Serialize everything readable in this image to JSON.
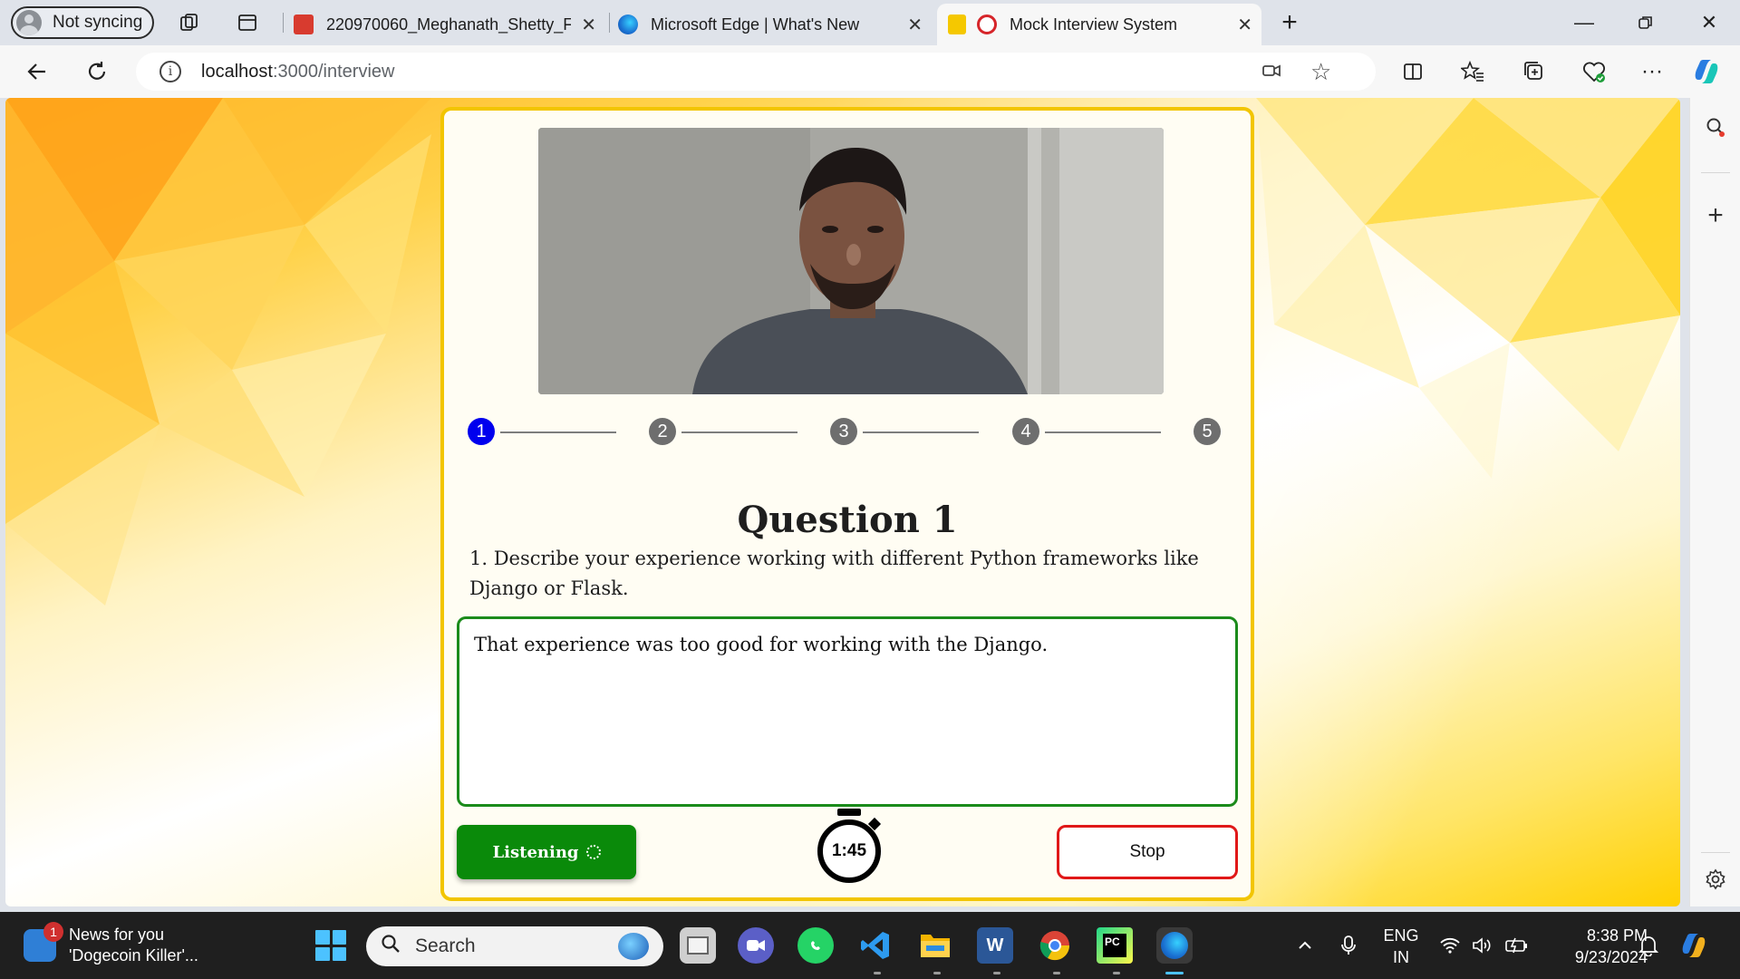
{
  "browser": {
    "profile_label": "Not syncing",
    "tabs": [
      {
        "label": "220970060_Meghanath_Shetty_Fi",
        "icon": "pdf-icon",
        "active": false
      },
      {
        "label": "Microsoft Edge | What's New",
        "icon": "edge-icon",
        "active": false
      },
      {
        "label": "Mock Interview System",
        "icon": "recording-icon",
        "active": true
      }
    ],
    "url_host": "localhost",
    "url_path": ":3000/interview"
  },
  "interview": {
    "steps": [
      "1",
      "2",
      "3",
      "4",
      "5"
    ],
    "active_step": 1,
    "question_title": "Question 1",
    "question_text": "1. Describe your experience working with different Python frameworks like Django or Flask.",
    "answer_text": "That experience was too good for working with the Django.",
    "listening_label": "Listening",
    "timer": "1:45",
    "stop_label": "Stop",
    "colors": {
      "active_step": "#0000ee",
      "answer_border": "#1b8b1b",
      "listening_bg": "#0a8a0a",
      "stop_border": "#e01818",
      "card_border": "#f2c500"
    }
  },
  "taskbar": {
    "news_badge": "1",
    "news_title": "News for you",
    "news_subtitle": "'Dogecoin Killer'...",
    "search_placeholder": "Search",
    "lang_top": "ENG",
    "lang_bottom": "IN",
    "time": "8:38 PM",
    "date": "9/23/2024"
  }
}
